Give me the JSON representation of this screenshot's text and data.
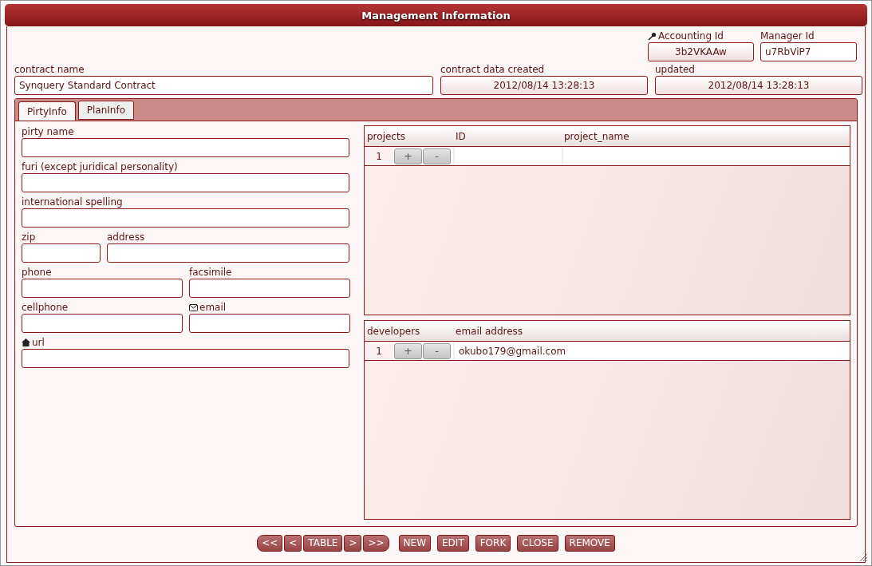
{
  "window": {
    "title": "Management Information"
  },
  "ids": [
    {
      "label": "Accounting Id",
      "value": "3b2VKAAw",
      "readonly": true
    },
    {
      "label": "Manager Id",
      "value": "u7RbViP7",
      "readonly": false
    }
  ],
  "header_fields": [
    {
      "label": "contract name",
      "value": "Synquery Standard Contract",
      "readonly": false,
      "kind": "wide"
    },
    {
      "label": "contract data created",
      "value": "2012/08/14 13:28:13",
      "readonly": true,
      "kind": "date"
    },
    {
      "label": "updated",
      "value": "2012/08/14 13:28:13",
      "readonly": true,
      "kind": "date"
    }
  ],
  "tabs": [
    {
      "label": "PirtyInfo",
      "selected": true
    },
    {
      "label": "PlanInfo",
      "selected": false
    }
  ],
  "form_rows": [
    [
      {
        "label": "pirty name",
        "kind": "full"
      }
    ],
    [
      {
        "label": "furi (except juridical personality)",
        "kind": "full"
      }
    ],
    [
      {
        "label": "international spelling",
        "kind": "full"
      }
    ],
    [
      {
        "label": "zip",
        "kind": "short"
      },
      {
        "label": "address",
        "kind": "grow"
      }
    ],
    [
      {
        "label": "phone",
        "kind": "half"
      },
      {
        "label": "facsimile",
        "kind": "half"
      }
    ],
    [
      {
        "label": "cellphone",
        "kind": "half"
      },
      {
        "label": "email",
        "kind": "half"
      }
    ],
    [
      {
        "label": "url",
        "kind": "full"
      }
    ]
  ],
  "grids": [
    {
      "columns": [
        "projects",
        "ID",
        "project_name"
      ],
      "rows": [
        {
          "add": "+",
          "remove": "-",
          "cells": [
            "1",
            "",
            ""
          ]
        }
      ]
    },
    {
      "columns": [
        "developers",
        "email address"
      ],
      "rows": [
        {
          "add": "+",
          "remove": "-",
          "cells": [
            "1",
            "okubo179@gmail.com"
          ]
        }
      ]
    }
  ],
  "nav_buttons": [
    "<<",
    "<",
    "TABLE",
    ">",
    ">>"
  ],
  "action_buttons": [
    "NEW",
    "EDIT",
    "FORK",
    "CLOSE",
    "REMOVE"
  ]
}
